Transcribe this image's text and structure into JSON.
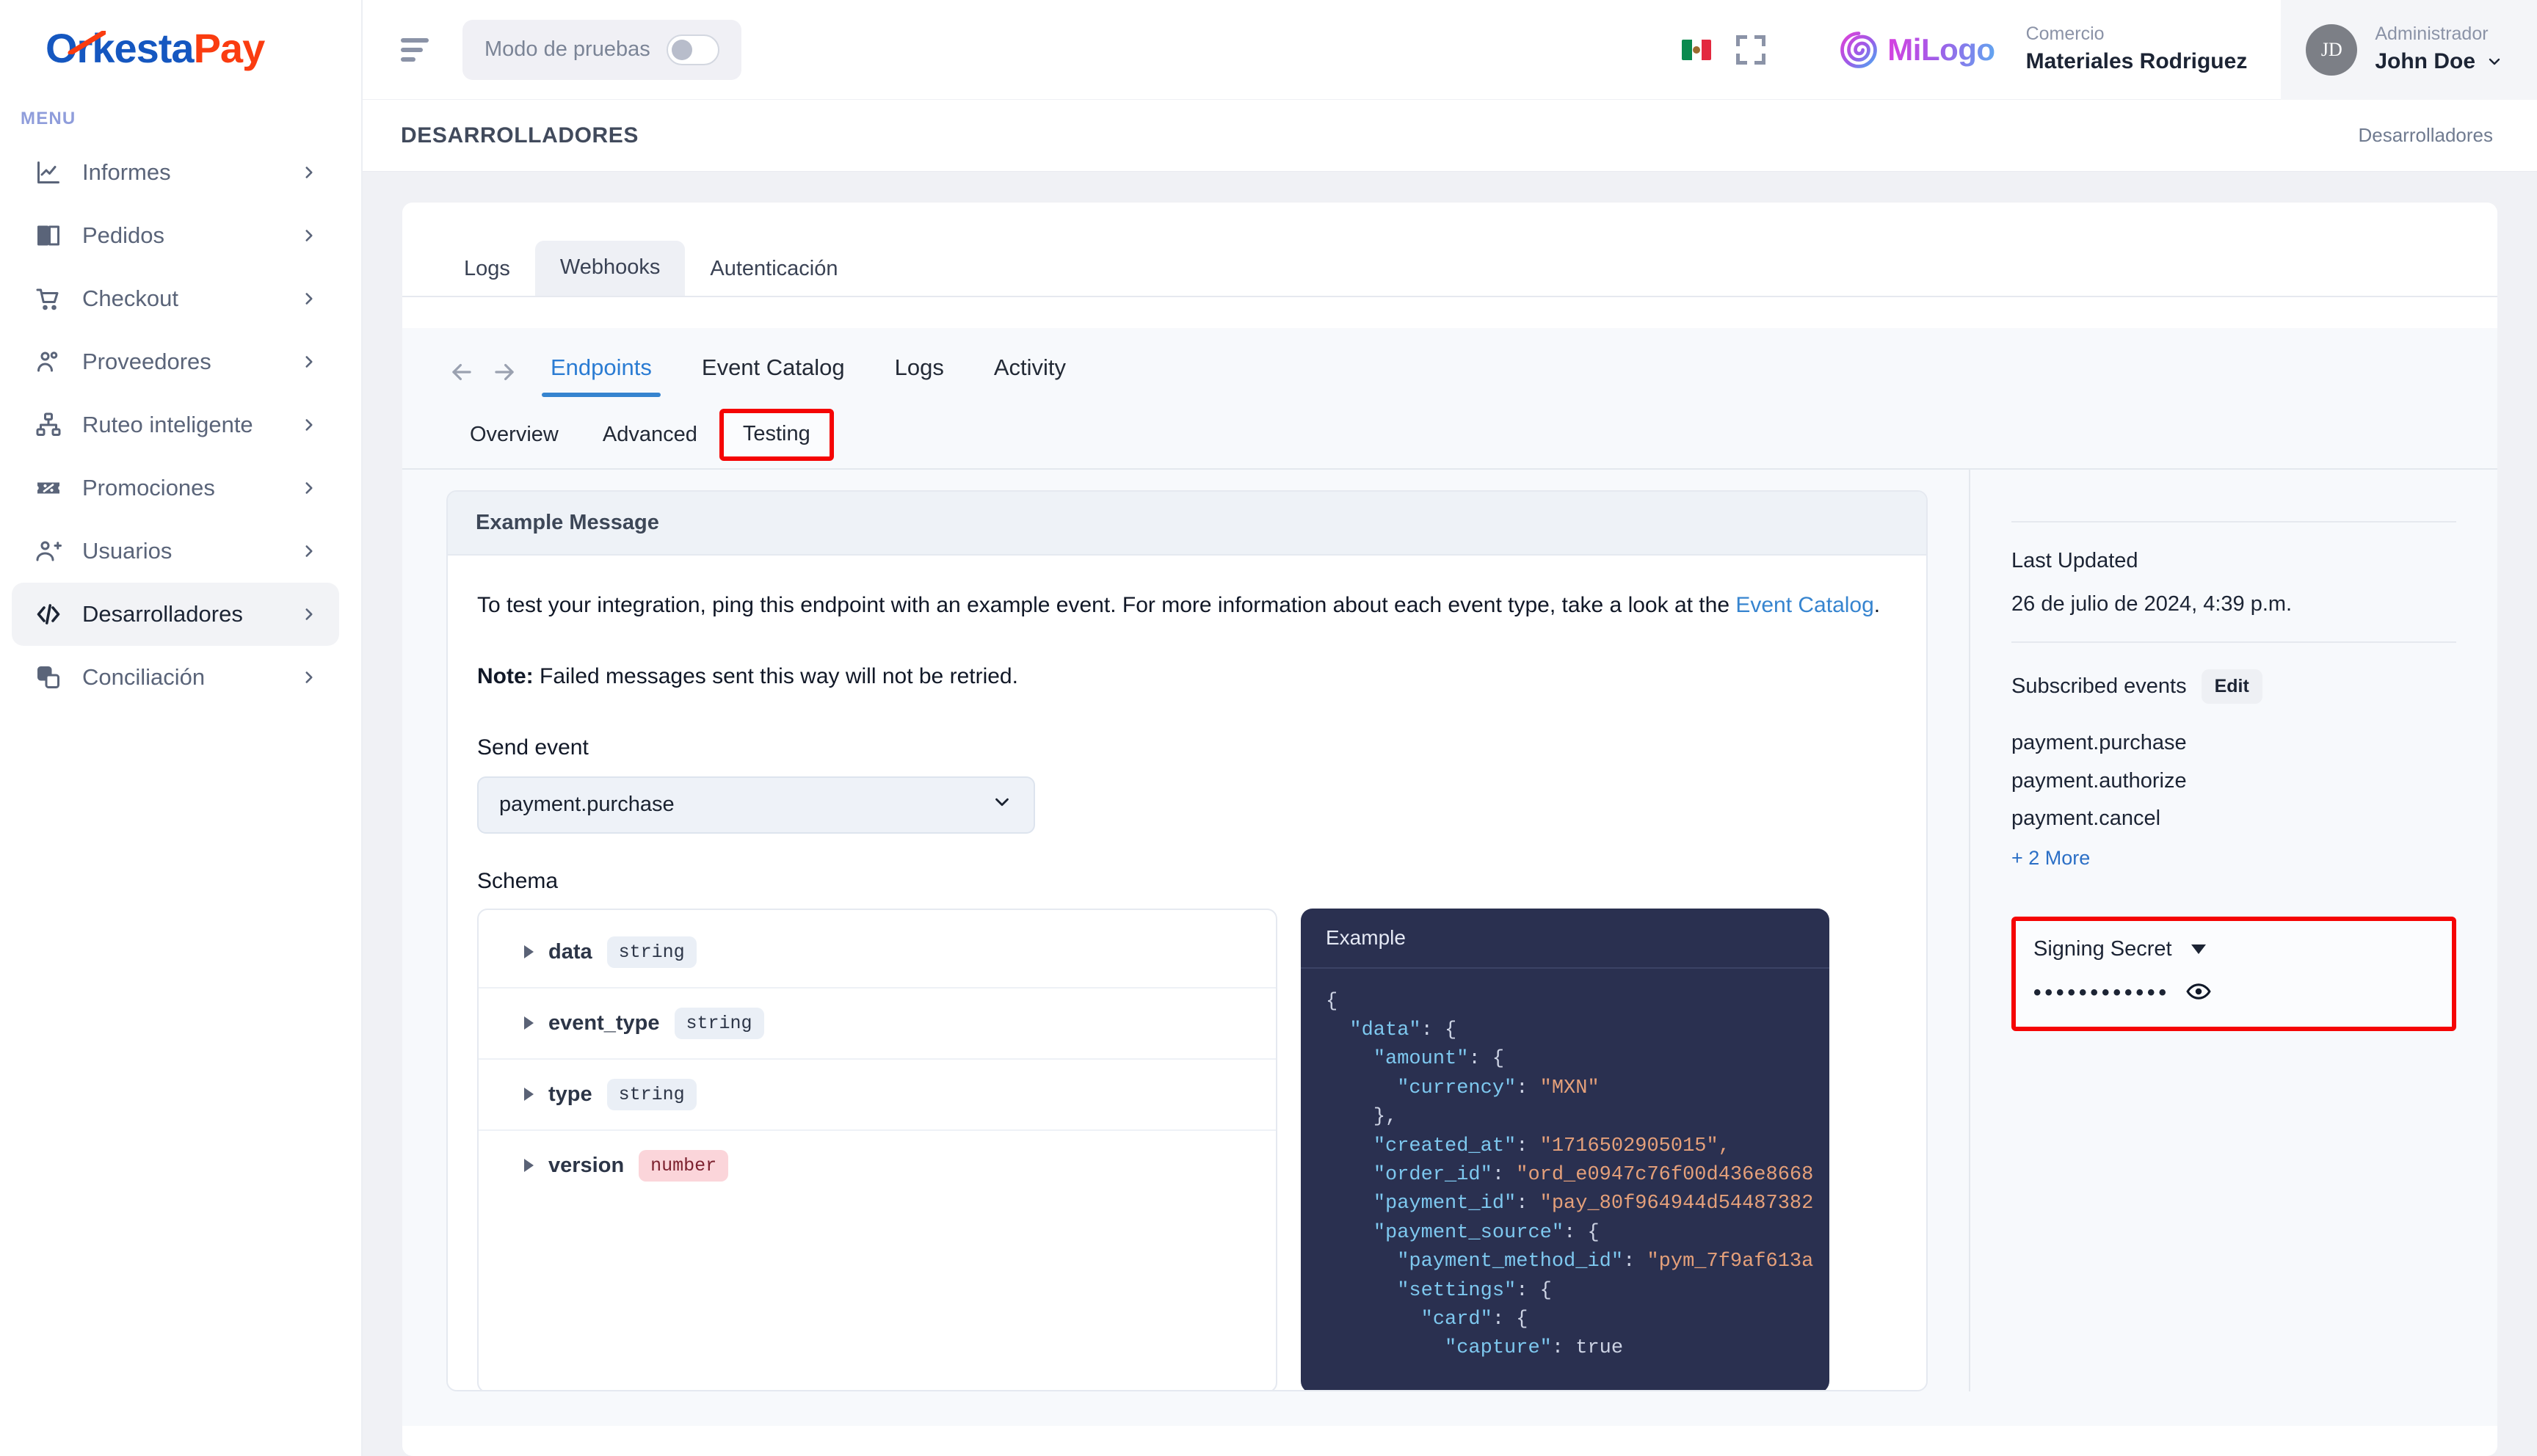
{
  "brand": {
    "logo_text_primary": "Orkesta",
    "logo_text_accent": "Pay",
    "menu_label": "MENU"
  },
  "sidebar": {
    "items": [
      {
        "label": "Informes",
        "icon": "chart-line-icon",
        "active": false
      },
      {
        "label": "Pedidos",
        "icon": "book-open-icon",
        "active": false
      },
      {
        "label": "Checkout",
        "icon": "shopping-cart-icon",
        "active": false
      },
      {
        "label": "Proveedores",
        "icon": "users-icon",
        "active": false
      },
      {
        "label": "Ruteo inteligente",
        "icon": "sitemap-icon",
        "active": false
      },
      {
        "label": "Promociones",
        "icon": "ticket-percent-icon",
        "active": false
      },
      {
        "label": "Usuarios",
        "icon": "user-plus-icon",
        "active": false
      },
      {
        "label": "Desarrolladores",
        "icon": "code-icon",
        "active": true
      },
      {
        "label": "Conciliación",
        "icon": "copy-layers-icon",
        "active": false
      }
    ]
  },
  "topbar": {
    "menu_toggle": "hamburger-icon",
    "test_mode_label": "Modo de pruebas",
    "test_mode_on": false,
    "locale_flag": "mexico-flag-icon",
    "fullscreen": "fullscreen-icon",
    "tenant_logo_text": "MiLogo",
    "merchant_caption": "Comercio",
    "merchant_name": "Materiales Rodriguez",
    "user_initials": "JD",
    "user_role": "Administrador",
    "user_name": "John Doe"
  },
  "pagebar": {
    "title": "DESARROLLADORES",
    "breadcrumb": "Desarrolladores"
  },
  "outer_tabs": [
    {
      "label": "Logs",
      "active": false
    },
    {
      "label": "Webhooks",
      "active": true
    },
    {
      "label": "Autenticación",
      "active": false
    }
  ],
  "svix": {
    "nav_tabs": [
      {
        "label": "Endpoints",
        "active": true
      },
      {
        "label": "Event Catalog",
        "active": false
      },
      {
        "label": "Logs",
        "active": false
      },
      {
        "label": "Activity",
        "active": false
      }
    ],
    "sub_tabs": [
      {
        "label": "Overview",
        "active": false,
        "highlighted": false
      },
      {
        "label": "Advanced",
        "active": false,
        "highlighted": false
      },
      {
        "label": "Testing",
        "active": true,
        "highlighted": true
      }
    ],
    "example_card": {
      "header": "Example Message",
      "paragraph_before_link": "To test your integration, ping this endpoint with an example event. For more information about each event type, take a look at the ",
      "link_text": "Event Catalog",
      "paragraph_after_link": ".",
      "note_bold": "Note:",
      "note_text": " Failed messages sent this way will not be retried."
    },
    "send_event": {
      "label": "Send event",
      "selected": "payment.purchase"
    },
    "schema": {
      "label": "Schema",
      "fields": [
        {
          "name": "data",
          "type": "string"
        },
        {
          "name": "event_type",
          "type": "string"
        },
        {
          "name": "type",
          "type": "string"
        },
        {
          "name": "version",
          "type": "number"
        }
      ]
    },
    "code_example": {
      "header": "Example",
      "lines": [
        {
          "indent": 0,
          "parts": [
            {
              "t": "p",
              "v": "{"
            }
          ]
        },
        {
          "indent": 1,
          "parts": [
            {
              "t": "k",
              "v": "\"data\""
            },
            {
              "t": "p",
              "v": ": {"
            }
          ]
        },
        {
          "indent": 2,
          "parts": [
            {
              "t": "k",
              "v": "\"amount\""
            },
            {
              "t": "p",
              "v": ": {"
            }
          ]
        },
        {
          "indent": 3,
          "parts": [
            {
              "t": "k",
              "v": "\"currency\""
            },
            {
              "t": "p",
              "v": ": "
            },
            {
              "t": "v",
              "v": "\"MXN\""
            }
          ]
        },
        {
          "indent": 2,
          "parts": [
            {
              "t": "p",
              "v": "},"
            }
          ]
        },
        {
          "indent": 2,
          "parts": [
            {
              "t": "k",
              "v": "\"created_at\""
            },
            {
              "t": "p",
              "v": ": "
            },
            {
              "t": "v",
              "v": "\"1716502905015\","
            }
          ]
        },
        {
          "indent": 2,
          "parts": [
            {
              "t": "k",
              "v": "\"order_id\""
            },
            {
              "t": "p",
              "v": ": "
            },
            {
              "t": "v",
              "v": "\"ord_e0947c76f00d436e8668"
            }
          ]
        },
        {
          "indent": 2,
          "parts": [
            {
              "t": "k",
              "v": "\"payment_id\""
            },
            {
              "t": "p",
              "v": ": "
            },
            {
              "t": "v",
              "v": "\"pay_80f964944d54487382"
            }
          ]
        },
        {
          "indent": 2,
          "parts": [
            {
              "t": "k",
              "v": "\"payment_source\""
            },
            {
              "t": "p",
              "v": ": {"
            }
          ]
        },
        {
          "indent": 3,
          "parts": [
            {
              "t": "k",
              "v": "\"payment_method_id\""
            },
            {
              "t": "p",
              "v": ": "
            },
            {
              "t": "v",
              "v": "\"pym_7f9af613a"
            }
          ]
        },
        {
          "indent": 3,
          "parts": [
            {
              "t": "k",
              "v": "\"settings\""
            },
            {
              "t": "p",
              "v": ": {"
            }
          ]
        },
        {
          "indent": 4,
          "parts": [
            {
              "t": "k",
              "v": "\"card\""
            },
            {
              "t": "p",
              "v": ": {"
            }
          ]
        },
        {
          "indent": 5,
          "parts": [
            {
              "t": "k",
              "v": "\"capture\""
            },
            {
              "t": "p",
              "v": ": true"
            }
          ]
        }
      ]
    },
    "side_panel": {
      "last_updated_label": "Last Updated",
      "last_updated_value": "26 de julio de 2024, 4:39 p.m.",
      "subscribed_events_label": "Subscribed events",
      "edit_label": "Edit",
      "subscribed_events": [
        "payment.purchase",
        "payment.authorize",
        "payment.cancel"
      ],
      "more_label": "+ 2 More",
      "signing_secret_label": "Signing Secret",
      "signing_secret_masked": "••••••••••••",
      "reveal_icon": "eye-icon"
    }
  },
  "colors": {
    "brand_blue": "#1557c0",
    "brand_orange": "#fa3c10",
    "accent_link": "#3684cf",
    "highlight_red": "#f50505",
    "code_bg": "#2a3050"
  }
}
